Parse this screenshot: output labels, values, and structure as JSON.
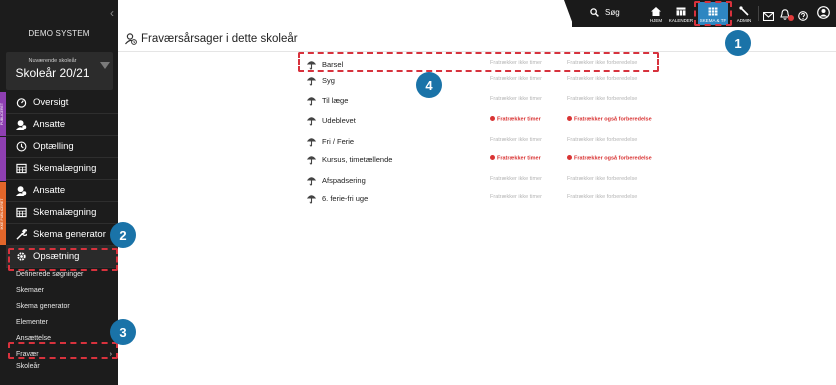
{
  "sidebar": {
    "system_name": "DEMO SYSTEM",
    "year_label": "Nuværende skoleår",
    "year_value": "Skoleår 20/21",
    "section1": "PUBLICERET",
    "section2": "IKKE PUBLICERET",
    "items": [
      {
        "label": "Oversigt",
        "icon": "dashboard-icon"
      },
      {
        "label": "Ansatte",
        "icon": "users-icon"
      },
      {
        "label": "Optælling",
        "icon": "clock-icon"
      },
      {
        "label": "Skemalægning",
        "icon": "calendar-icon"
      },
      {
        "label": "Ansatte",
        "icon": "users-icon"
      },
      {
        "label": "Skemalægning",
        "icon": "calendar-icon"
      },
      {
        "label": "Skema generator",
        "icon": "wrench-icon"
      },
      {
        "label": "Opsætning",
        "icon": "gear-icon"
      }
    ],
    "subitems": [
      "Definerede søgninger",
      "Skemaer",
      "Skema generator",
      "Elementer",
      "Ansættelse",
      "Fravær",
      "Skoleår"
    ]
  },
  "topbar": {
    "search_label": "Søg",
    "buttons": [
      "HJEM",
      "KALENDER",
      "SKEMA & TF",
      "ADMIN"
    ],
    "accent": "#2e86c1"
  },
  "page": {
    "title": "Fraværsårsager i dette skoleår"
  },
  "rows": [
    {
      "name": "Barsel",
      "c1": "Fratrækker ikke timer",
      "c2": "Fratrækker ikke forberedelse",
      "c1_red": false,
      "c2_red": false
    },
    {
      "name": "Syg",
      "c1": "Fratrækker ikke timer",
      "c2": "Fratrækker ikke forberedelse",
      "c1_red": false,
      "c2_red": false
    },
    {
      "name": "Til læge",
      "c1": "Fratrækker ikke timer",
      "c2": "Fratrækker ikke forberedelse",
      "c1_red": false,
      "c2_red": false
    },
    {
      "name": "Udeblevet",
      "c1": "Fratrækker timer",
      "c2": "Fratrækker også forberedelse",
      "c1_red": true,
      "c2_red": true
    },
    {
      "name": "Fri / Ferie",
      "c1": "Fratrækker ikke timer",
      "c2": "Fratrækker ikke forberedelse",
      "c1_red": false,
      "c2_red": false
    },
    {
      "name": "Kursus, timetællende",
      "c1": "Fratrækker timer",
      "c2": "Fratrækker også forberedelse",
      "c1_red": true,
      "c2_red": true
    },
    {
      "name": "Afspadsering",
      "c1": "Fratrækker ikke timer",
      "c2": "Fratrækker ikke forberedelse",
      "c1_red": false,
      "c2_red": false
    },
    {
      "name": "6. ferie-fri uge",
      "c1": "Fratrækker ikke timer",
      "c2": "Fratrækker ikke forberedelse",
      "c1_red": false,
      "c2_red": false
    }
  ],
  "callouts": [
    "1",
    "2",
    "3",
    "4"
  ],
  "colors": {
    "callout": "#1a73a8",
    "dash": "#d7323d",
    "warning": "#d93434"
  }
}
